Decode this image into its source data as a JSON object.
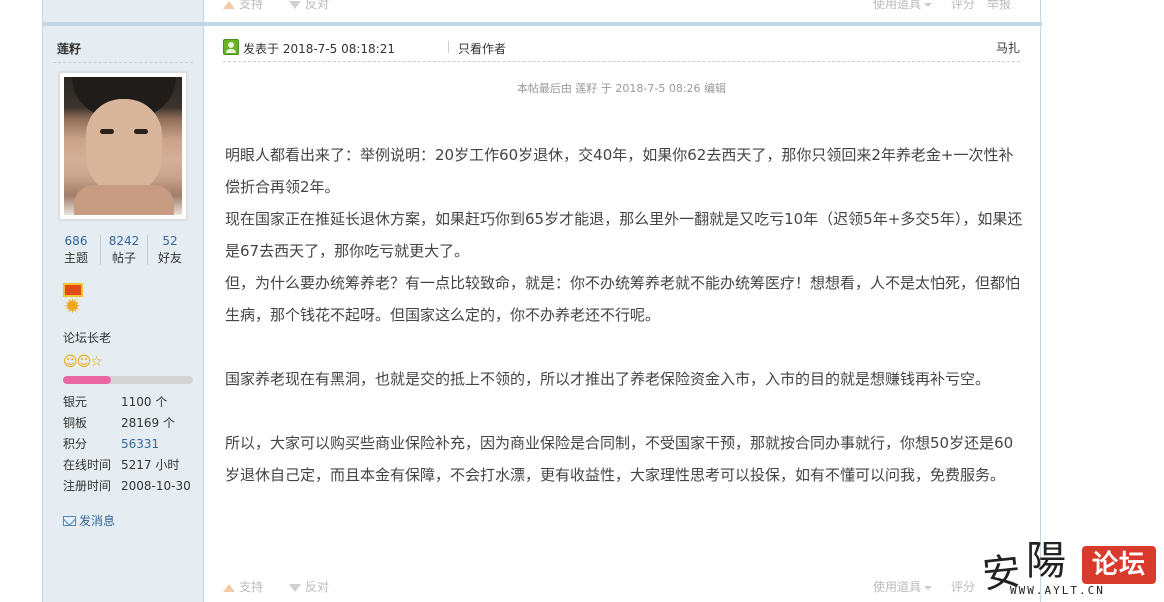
{
  "prev_post_footer": {
    "support_label": "支持",
    "oppose_label": "反对",
    "tools_label": "使用道具",
    "rate_label": "评分",
    "report_label": "举报"
  },
  "author": {
    "name": "莲籽",
    "stats": [
      {
        "value": "686",
        "label": "主题"
      },
      {
        "value": "8242",
        "label": "帖子"
      },
      {
        "value": "52",
        "label": "好友"
      }
    ],
    "rank_title": "论坛长老",
    "rank_stars": "☺☺☆",
    "rank_progress": 0.37,
    "details": [
      {
        "key": "银元",
        "value": "1100 个"
      },
      {
        "key": "铜板",
        "value": "28169 个"
      },
      {
        "key": "积分",
        "value": "56331"
      },
      {
        "key": "在线时间",
        "value": "5217 小时"
      },
      {
        "key": "注册时间",
        "value": "2008-10-30"
      }
    ],
    "send_message_label": "发消息"
  },
  "post": {
    "posted_at": "发表于 2018-7-5 08:18:21",
    "only_author_label": "只看作者",
    "floor_label": "马扎",
    "edit_note": "本帖最后由 莲籽 于 2018-7-5 08:26 编辑",
    "paragraphs": [
      "明眼人都看出来了：举例说明：20岁工作60岁退休，交40年，如果你62去西天了，那你只领回来2年养老金+一次性补偿折合再领2年。",
      "现在国家正在推延长退休方案，如果赶巧你到65岁才能退，那么里外一翻就是又吃亏10年（迟领5年+多交5年），如果还是67去西天了，那你吃亏就更大了。",
      "但，为什么要办统筹养老？有一点比较致命，就是：你不办统筹养老就不能办统筹医疗！想想看，人不是太怕死，但都怕生病，那个钱花不起呀。但国家这么定的，你不办养老还不行呢。",
      "",
      "国家养老现在有黑洞，也就是交的抵上不领的，所以才推出了养老保险资金入市，入市的目的就是想赚钱再补亏空。",
      "",
      "所以，大家可以购买些商业保险补充，因为商业保险是合同制，不受国家干预，那就按合同办事就行，你想50岁还是60岁退休自己定，而且本金有保障，不会打水漂，更有收益性，大家理性思考可以投保，如有不懂可以问我，免费服务。"
    ]
  },
  "post_footer": {
    "support_label": "支持",
    "oppose_label": "反对",
    "tools_label": "使用道具",
    "rate_label": "评分"
  },
  "watermark": {
    "char1": "安",
    "char2": "陽",
    "badge": "论坛",
    "url": "WWW.AYLT.CN"
  },
  "colors": {
    "sidebar_bg": "#e5edf2",
    "border": "#c2d5e3",
    "link": "#336699",
    "progress": "#e966a3",
    "badge": "#d83a2b"
  }
}
